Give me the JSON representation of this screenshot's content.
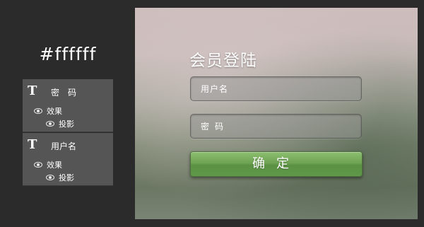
{
  "design_panel": {
    "color_label": "#ffffff",
    "layers": [
      {
        "icon": "T",
        "name": "密　码",
        "effects_label": "效果",
        "shadow_label": "投影"
      },
      {
        "icon": "T",
        "name": "用户名",
        "effects_label": "效果",
        "shadow_label": "投影"
      }
    ]
  },
  "login": {
    "title": "会员登陆",
    "username_placeholder": "用户名",
    "password_placeholder": "密码",
    "confirm_label": "确定",
    "button_color": "#6fa453"
  }
}
